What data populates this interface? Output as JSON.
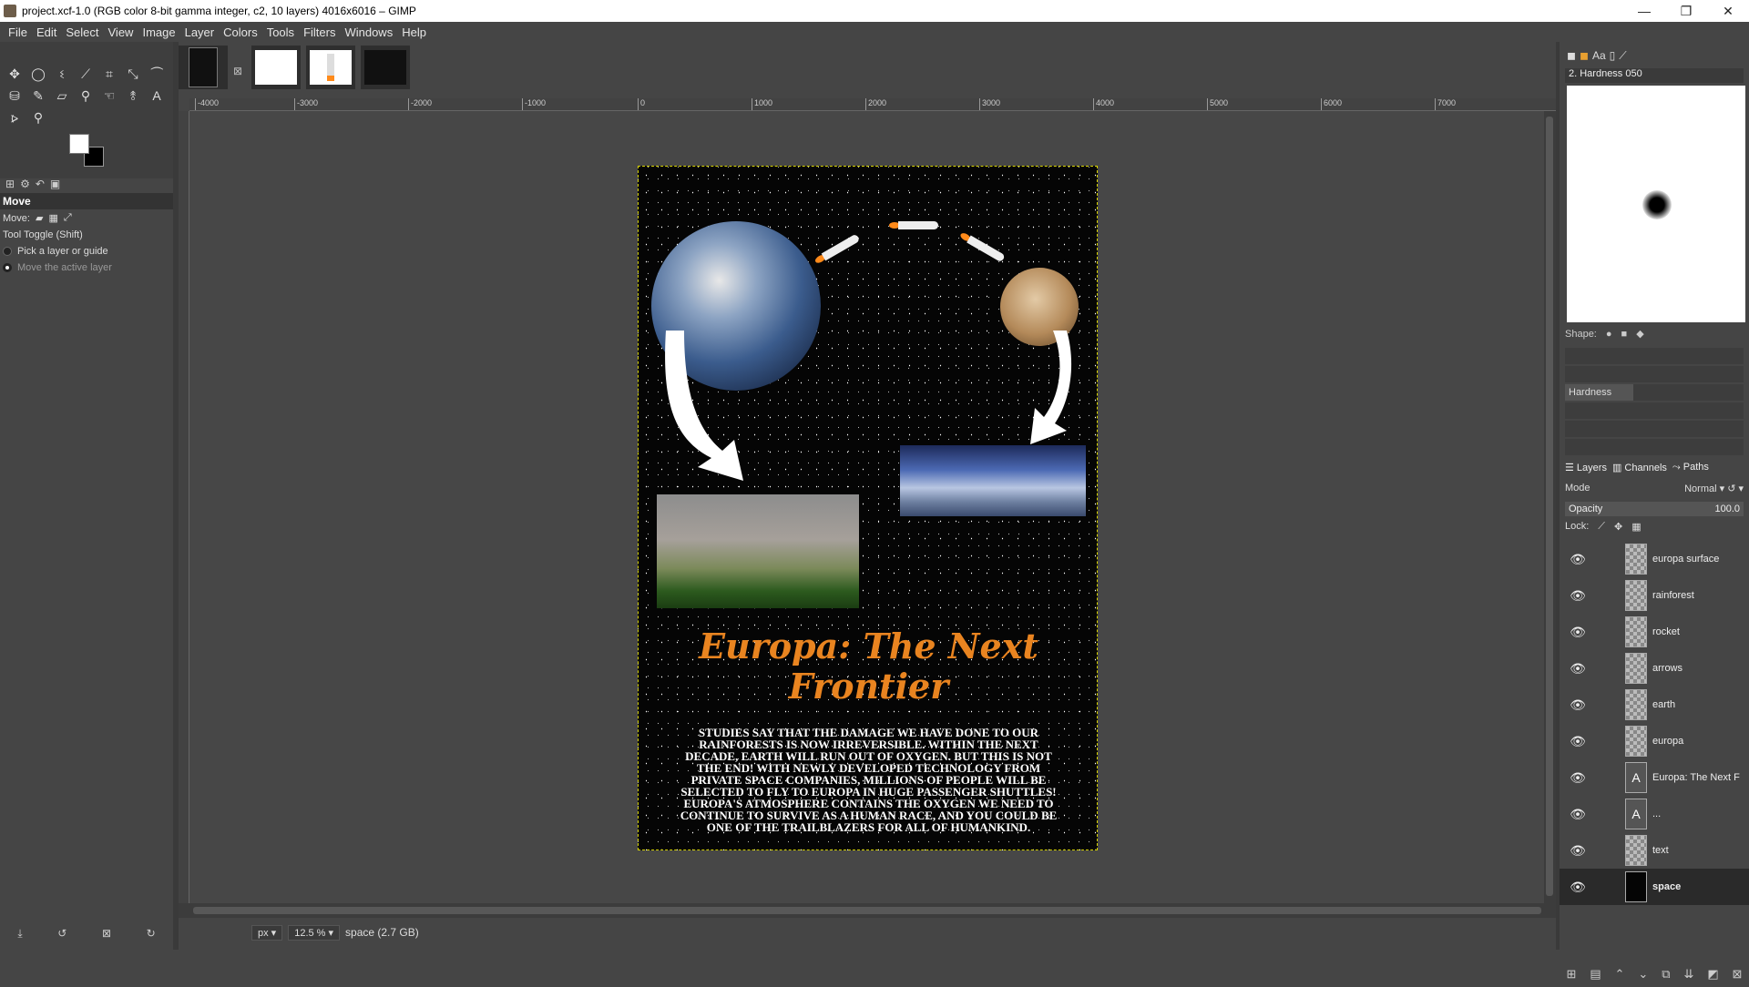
{
  "window": {
    "title": "project.xcf-1.0 (RGB color 8-bit gamma integer, c2, 10 layers) 4016x6016 – GIMP",
    "minimize": "—",
    "maximize": "❐",
    "close": "✕"
  },
  "menu": [
    "File",
    "Edit",
    "Select",
    "View",
    "Image",
    "Layer",
    "Colors",
    "Tools",
    "Filters",
    "Windows",
    "Help"
  ],
  "tool_options": {
    "title": "Move",
    "move_label": "Move:",
    "toggle_label": "Tool Toggle  (Shift)",
    "option1": "Pick a layer or guide",
    "option2": "Move the active layer"
  },
  "ruler_ticks": [
    "-4000",
    "-3000",
    "-2000",
    "-1000",
    "0",
    "1000",
    "2000",
    "3000",
    "4000",
    "5000",
    "6000",
    "7000"
  ],
  "poster": {
    "headline_line1": "Europa: The Next",
    "headline_line2": "Frontier",
    "body": "Studies say that the damage we have done to our rainforests is now irreversible. Within the next decade, Earth will run out of oxygen. But this is not the end! With newly developed technology from private space companies, millions of people will be selected to fly to Europa in huge passenger shuttles! Europa's atmosphere contains the oxygen we need to continue to survive as a human race, and you could be one of the trailblazers for all of humankind."
  },
  "status": {
    "unit": "px",
    "zoom": "12.5 %",
    "info": "space (2.7 GB)"
  },
  "brushes": {
    "name": "2. Hardness 050",
    "shape_label": "Shape:",
    "hardness_label": "Hardness",
    "hardness": 0.5
  },
  "layers_panel": {
    "tab_layers": "Layers",
    "tab_channels": "Channels",
    "tab_paths": "Paths",
    "mode_label": "Mode",
    "mode_value": "Normal",
    "opacity_label": "Opacity",
    "opacity_value": "100.0",
    "lock_label": "Lock:",
    "layers": [
      {
        "name": "europa surface",
        "kind": "image"
      },
      {
        "name": "rainforest",
        "kind": "image"
      },
      {
        "name": "rocket",
        "kind": "image"
      },
      {
        "name": "arrows",
        "kind": "image"
      },
      {
        "name": "earth",
        "kind": "image"
      },
      {
        "name": "europa",
        "kind": "image"
      },
      {
        "name": "Europa: The Next F",
        "kind": "text"
      },
      {
        "name": "...",
        "kind": "text"
      },
      {
        "name": "text",
        "kind": "image"
      },
      {
        "name": "space",
        "kind": "dark"
      }
    ]
  },
  "colors": {
    "headline": "#e98420",
    "selection_border": "#d8d400",
    "foreground": "#ffffff",
    "background": "#000000"
  }
}
